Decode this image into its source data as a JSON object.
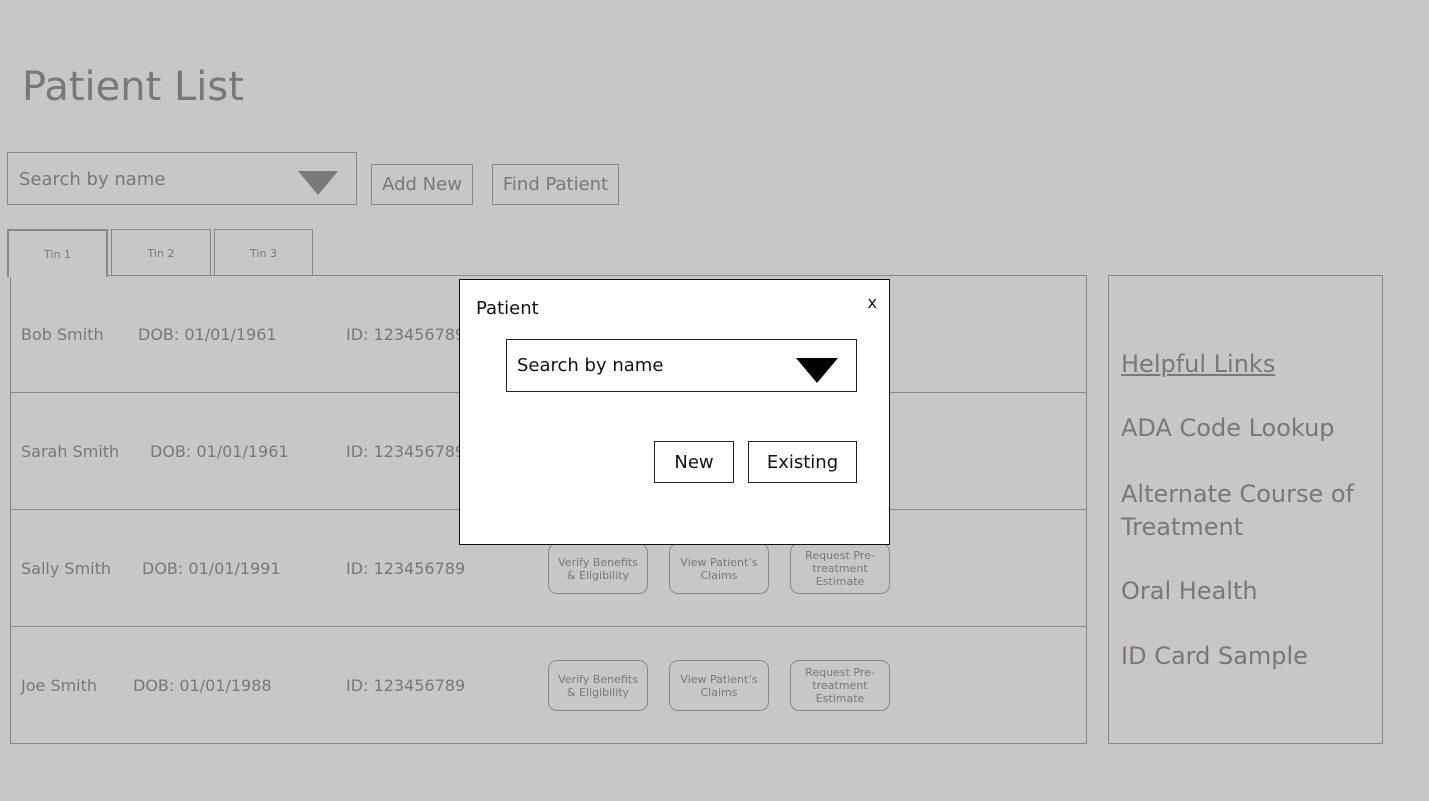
{
  "header": {
    "title": "Patient List"
  },
  "toolbar": {
    "search_placeholder": "Search by name",
    "add_new_label": "Add New",
    "find_patient_label": "Find Patient"
  },
  "tabs": [
    {
      "label": "Tin 1",
      "active": true
    },
    {
      "label": "Tin 2",
      "active": false
    },
    {
      "label": "Tin 3",
      "active": false
    }
  ],
  "patients": [
    {
      "name": "Bob Smith",
      "dob": "DOB: 01/01/1961",
      "id": "ID: 123456789"
    },
    {
      "name": "Sarah Smith",
      "dob": "DOB: 01/01/1961",
      "id": "ID: 123456789"
    },
    {
      "name": "Sally Smith",
      "dob": "DOB: 01/01/1991",
      "id": "ID: 123456789"
    },
    {
      "name": "Joe Smith",
      "dob": "DOB: 01/01/1988",
      "id": "ID: 123456789"
    }
  ],
  "row_actions": {
    "verify": "Verify Benefits & Eligibility",
    "claims": "View Patient’s Claims",
    "estimate": "Request Pre-treatment Estimate"
  },
  "helpful_links": {
    "heading": "Helpful Links",
    "items": [
      "ADA Code Lookup",
      "Alternate Course of Treatment",
      "Oral Health",
      "ID Card Sample"
    ]
  },
  "modal": {
    "title": "Patient",
    "close_label": "x",
    "search_placeholder": "Search by name",
    "new_label": "New",
    "existing_label": "Existing"
  },
  "colors": {
    "background": "#c8c7c5",
    "muted_text": "#7a7876",
    "border": "#8a8886",
    "modal_background": "#ffffff",
    "modal_text": "#111111"
  },
  "icons": {
    "toolbar_dropdown": "triangle-down-icon",
    "modal_dropdown": "triangle-down-icon"
  }
}
